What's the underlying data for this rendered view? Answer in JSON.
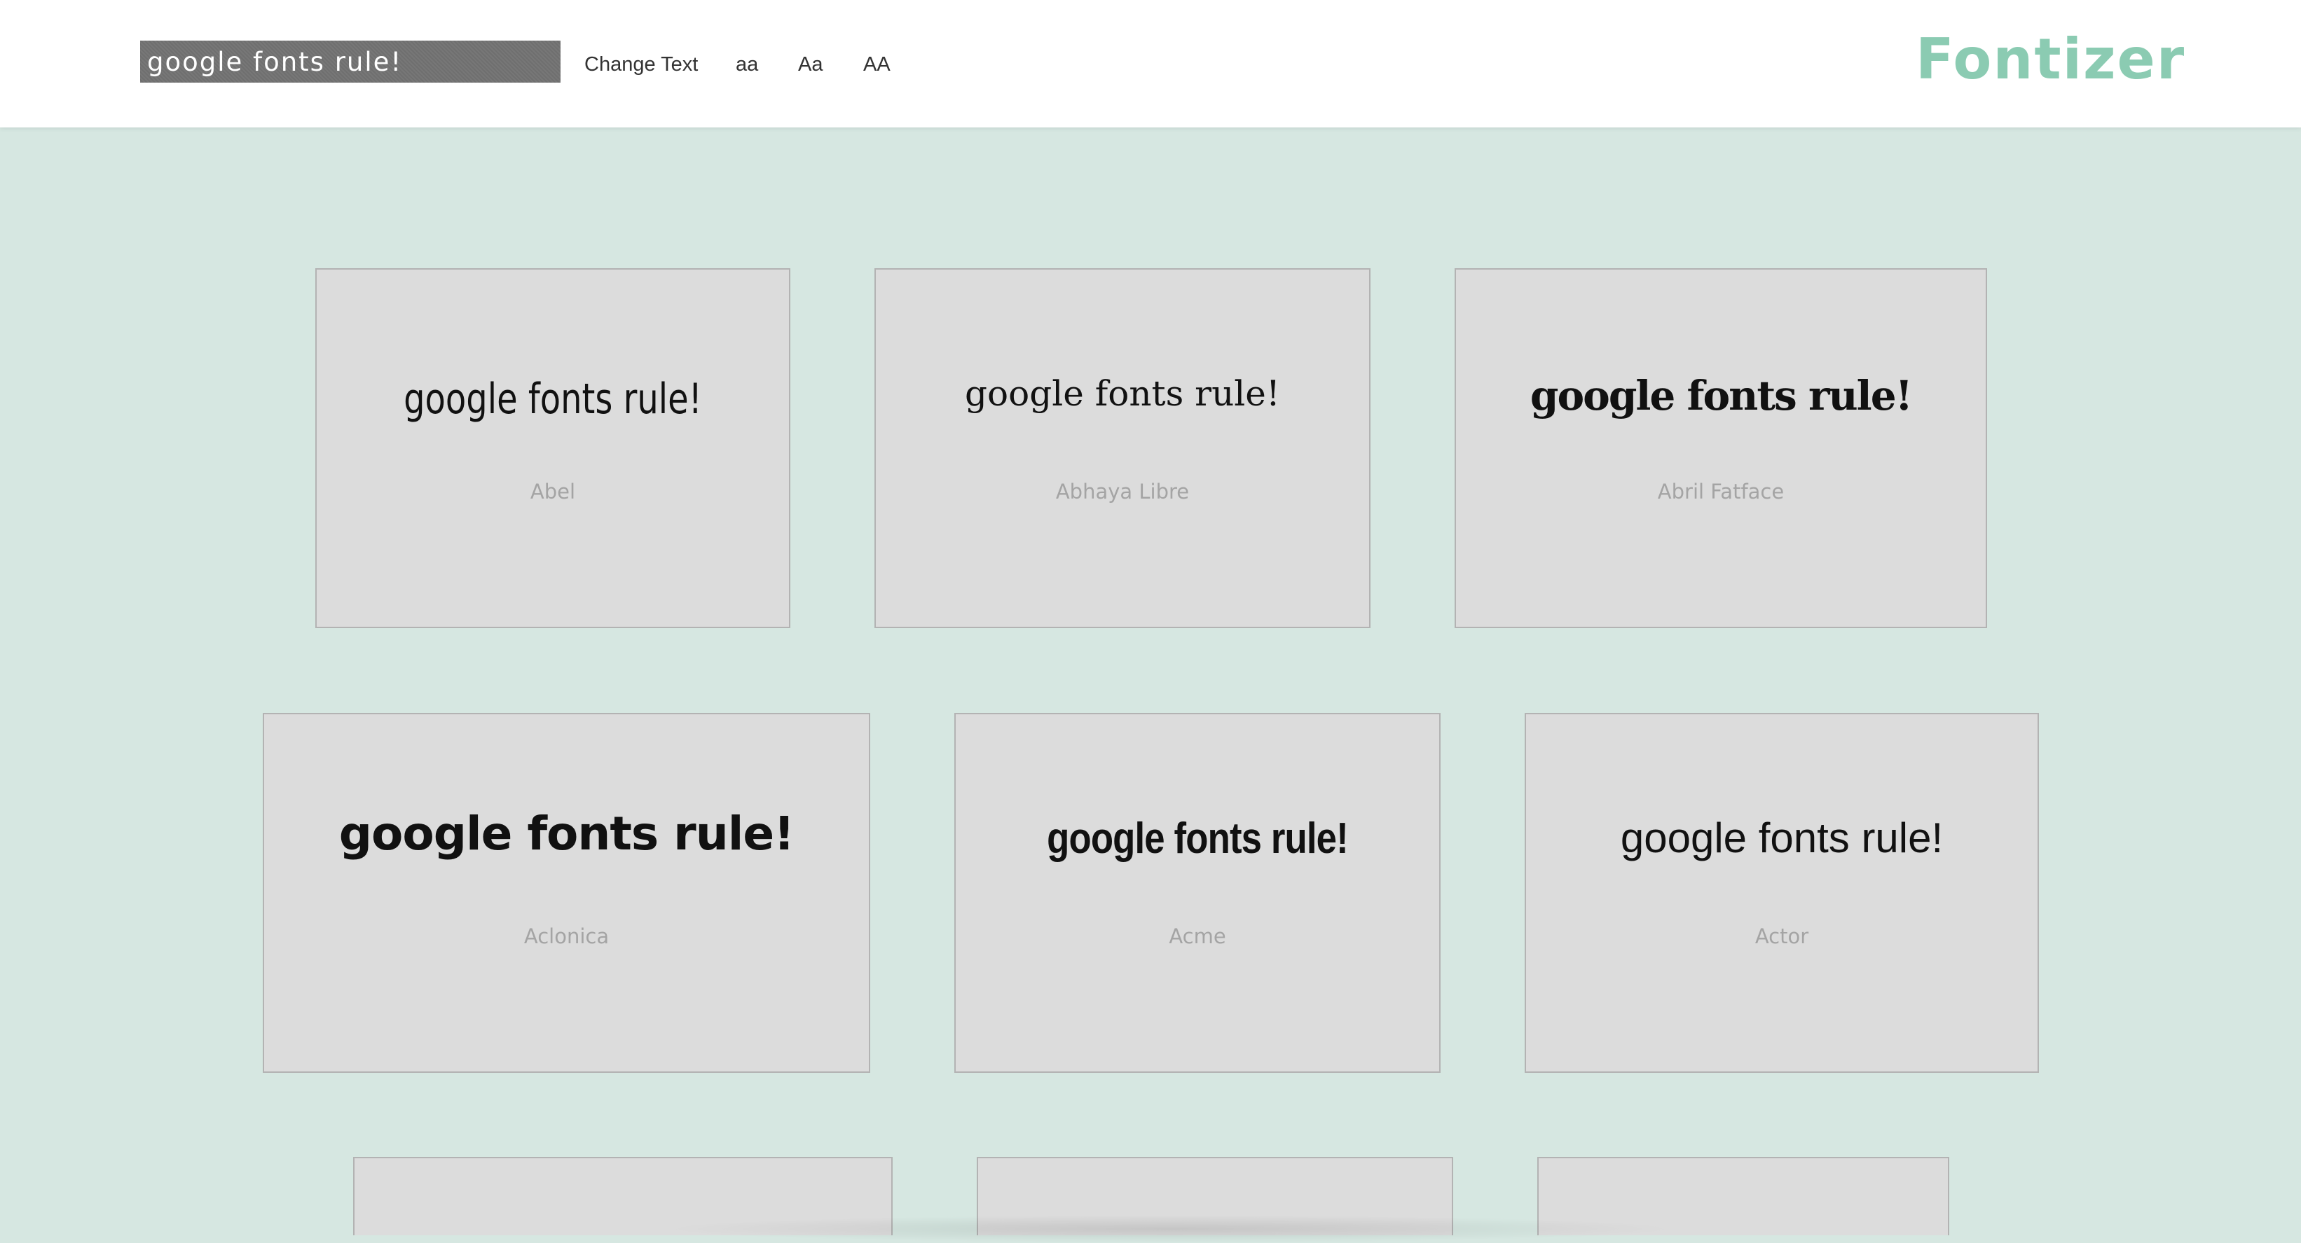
{
  "header": {
    "text_input_value": "google fonts rule!",
    "change_text_label": "Change Text",
    "case_lower_label": "aa",
    "case_title_label": "Aa",
    "case_upper_label": "AA",
    "logo": "Fontizer"
  },
  "cards": [
    {
      "sample": "google fonts rule!",
      "name": "Abel"
    },
    {
      "sample": "google fonts rule!",
      "name": "Abhaya Libre"
    },
    {
      "sample": "google fonts rule!",
      "name": "Abril Fatface"
    },
    {
      "sample": "google fonts rule!",
      "name": "Aclonica"
    },
    {
      "sample": "google fonts rule!",
      "name": "Acme"
    },
    {
      "sample": "google fonts rule!",
      "name": "Actor"
    }
  ],
  "colors": {
    "page_background": "#d6e7e1",
    "logo": "#8bcbb2",
    "card_background": "#dcdcdc",
    "input_background": "#6f6f6f"
  }
}
